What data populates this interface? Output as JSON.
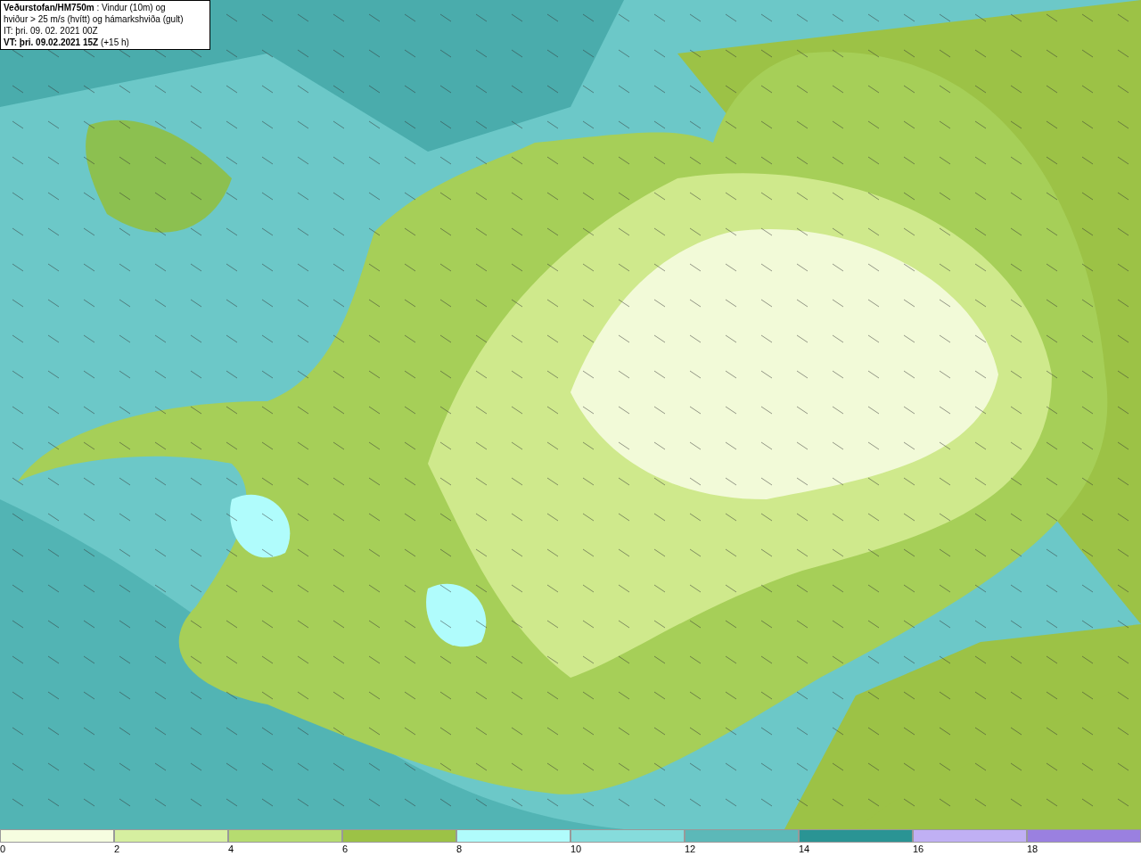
{
  "header": {
    "lines": [
      "**Veðurstofan/HM750m** : Vindur (10m) og",
      "hviður > 25 m/s (hvítt) og hámarkshviða (gult)",
      "IT: þri. 09. 02. 2021 00Z",
      "**VT: þri. 09.02.2021 15Z** (+15 h)"
    ]
  },
  "legend": [
    {
      "label": "0",
      "color": "#f6fde0"
    },
    {
      "label": "2",
      "color": "#d6efa0"
    },
    {
      "label": "4",
      "color": "#b6dc70"
    },
    {
      "label": "6",
      "color": "#9cc246"
    },
    {
      "label": "8",
      "color": "#b0fcfc"
    },
    {
      "label": "10",
      "color": "#86dcdc"
    },
    {
      "label": "12",
      "color": "#5cb8b8"
    },
    {
      "label": "14",
      "color": "#2a9494"
    },
    {
      "label": "16",
      "color": "#c0b0f4"
    },
    {
      "label": "18",
      "color": "#9a80e0"
    }
  ]
}
